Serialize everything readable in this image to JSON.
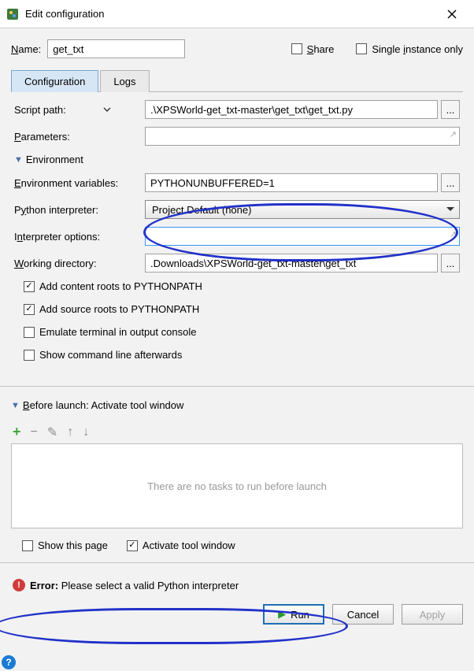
{
  "window": {
    "title": "Edit configuration"
  },
  "name": {
    "label_prefix": "N",
    "label_rest": "ame:",
    "value": "get_txt"
  },
  "share": {
    "label_prefix": "S",
    "label_rest": "hare",
    "checked": false
  },
  "single_instance": {
    "label_pre": "Single ",
    "label_u": "i",
    "label_post": "nstance only",
    "checked": false
  },
  "tabs": {
    "configuration": "Configuration",
    "logs": "Logs"
  },
  "config": {
    "script_path": {
      "label": "Script path:",
      "value": ".\\XPSWorld-get_txt-master\\get_txt\\get_txt.py"
    },
    "parameters": {
      "label_u": "P",
      "label_rest": "arameters:",
      "value": ""
    },
    "env_header": "Environment",
    "env_vars": {
      "label_u": "E",
      "label_rest": "nvironment variables:",
      "value": "PYTHONUNBUFFERED=1"
    },
    "python_interp": {
      "label_pre": "P",
      "label_u": "y",
      "label_post": "thon interpreter:",
      "value": "Project Default (none)"
    },
    "interp_opts": {
      "label_pre": "I",
      "label_u": "n",
      "label_post": "terpreter options:",
      "value": ""
    },
    "working_dir": {
      "label_u": "W",
      "label_post": "orking directory:",
      "value": ".Downloads\\XPSWorld-get_txt-master\\get_txt"
    },
    "add_content_roots": {
      "label": "Add content roots to PYTHONPATH",
      "checked": true
    },
    "add_source_roots": {
      "label": "Add source roots to PYTHONPATH",
      "checked": true
    },
    "emulate_terminal": {
      "label": "Emulate terminal in output console",
      "checked": false
    },
    "show_cmdline": {
      "label": "Show command line afterwards",
      "checked": false
    }
  },
  "before_launch": {
    "header_u": "B",
    "header_rest": "efore launch: Activate tool window",
    "empty_text": "There are no tasks to run before launch",
    "show_this_page": {
      "label": "Show this page",
      "checked": false
    },
    "activate_tool": {
      "label": "Activate tool window",
      "checked": true
    }
  },
  "error": {
    "prefix": "Error:",
    "message": " Please select a valid Python interpreter"
  },
  "buttons": {
    "run": "Run",
    "cancel": "Cancel",
    "apply": "Apply"
  }
}
